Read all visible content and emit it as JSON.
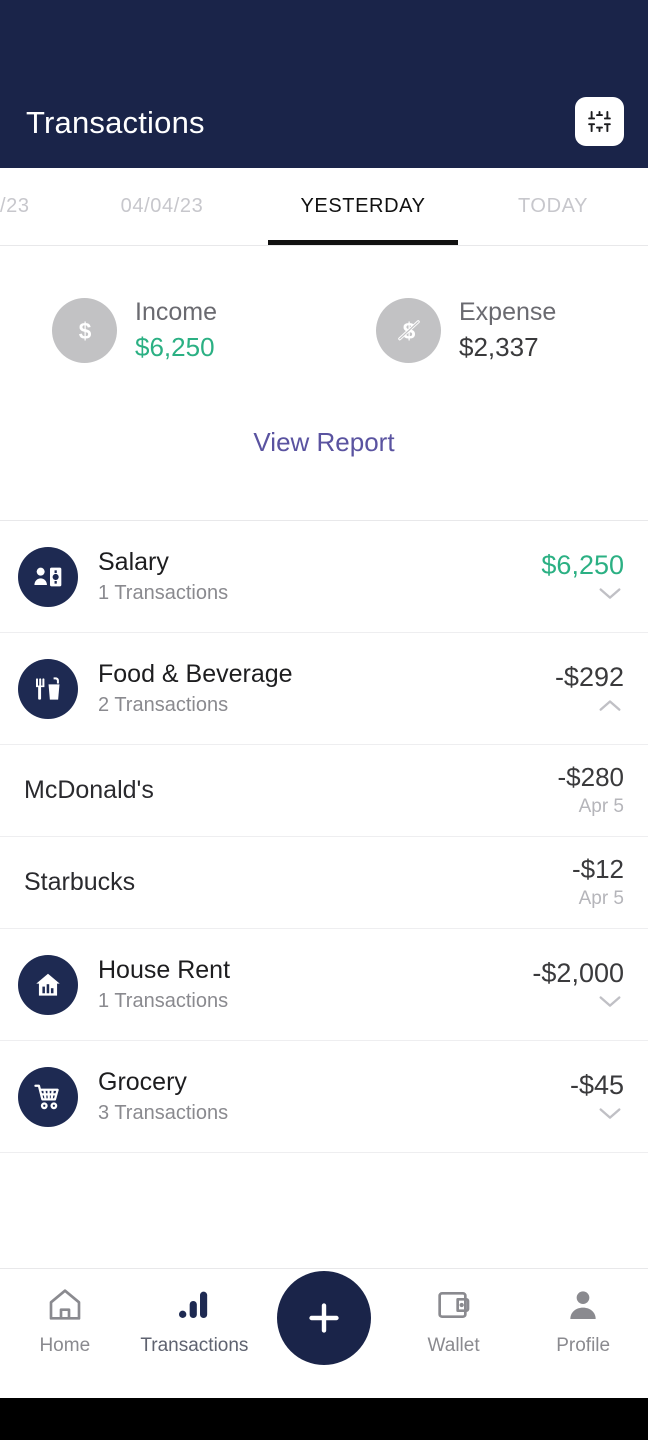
{
  "header": {
    "title": "Transactions",
    "filter_icon": "sliders-filter-icon"
  },
  "tabs": [
    {
      "label": "/23",
      "active": false
    },
    {
      "label": "04/04/23",
      "active": false
    },
    {
      "label": "YESTERDAY",
      "active": true
    },
    {
      "label": "TODAY",
      "active": false
    }
  ],
  "summary": {
    "income": {
      "label": "Income",
      "amount": "$6,250",
      "icon": "dollar-circle-icon"
    },
    "expense": {
      "label": "Expense",
      "amount": "$2,337",
      "icon": "dollar-slash-circle-icon"
    },
    "view_report_label": "View Report"
  },
  "transactions": [
    {
      "name": "Salary",
      "count": "1 Transactions",
      "amount": "$6,250",
      "positive": true,
      "icon": "salary-person-money-icon",
      "expanded": false,
      "chevron": "chevron-down-icon",
      "items": []
    },
    {
      "name": "Food & Beverage",
      "count": "2 Transactions",
      "amount": "-$292",
      "positive": false,
      "icon": "food-fork-cup-icon",
      "expanded": true,
      "chevron": "chevron-up-icon",
      "items": [
        {
          "name": "McDonald's",
          "amount": "-$280",
          "date": "Apr 5"
        },
        {
          "name": "Starbucks",
          "amount": "-$12",
          "date": "Apr 5"
        }
      ]
    },
    {
      "name": "House Rent",
      "count": "1 Transactions",
      "amount": "-$2,000",
      "positive": false,
      "icon": "house-rent-icon",
      "expanded": false,
      "chevron": "chevron-down-icon",
      "items": []
    },
    {
      "name": "Grocery",
      "count": "3 Transactions",
      "amount": "-$45",
      "positive": false,
      "icon": "shopping-cart-icon",
      "expanded": false,
      "chevron": "chevron-down-icon",
      "items": []
    }
  ],
  "bottom_nav": {
    "items": [
      {
        "label": "Home",
        "icon": "home-icon",
        "active": false
      },
      {
        "label": "Transactions",
        "icon": "bar-chart-icon",
        "active": true
      },
      {
        "label": "Wallet",
        "icon": "wallet-icon",
        "active": false
      },
      {
        "label": "Profile",
        "icon": "person-icon",
        "active": false
      }
    ],
    "add_button_icon": "plus-icon"
  },
  "colors": {
    "navy": "#1a2449",
    "green": "#2bb083",
    "purple": "#5a53a0",
    "muted": "#8a8a8f"
  }
}
